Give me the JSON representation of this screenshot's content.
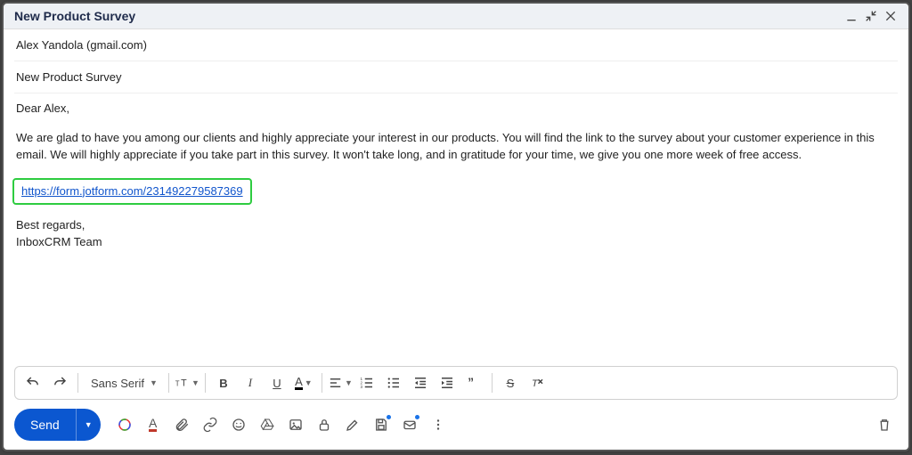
{
  "header": {
    "title": "New Product Survey"
  },
  "fields": {
    "to": "Alex Yandola (gmail.com)",
    "subject": "New Product Survey"
  },
  "body": {
    "greeting": "Dear Alex,",
    "paragraph": "We are glad to have you among our clients and highly appreciate your interest in our products. You will find the link to the survey about your customer experience in this email. We will highly appreciate if you take part in this survey. It won't take long, and in gratitude for your time, we give you one more week of free access.",
    "link_text": "https://form.jotform.com/231492279587369",
    "link_href": "https://form.jotform.com/231492279587369",
    "sign1": "Best regards,",
    "sign2": "InboxCRM Team"
  },
  "toolbar": {
    "font_family": "Sans Serif",
    "send_label": "Send"
  }
}
